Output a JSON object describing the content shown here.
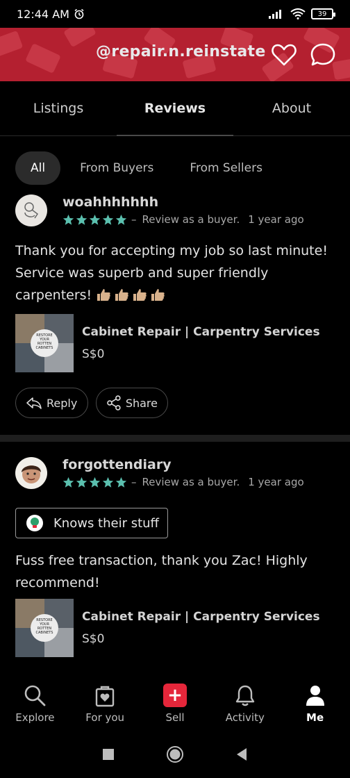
{
  "status": {
    "time": "12:44 AM",
    "battery": "39"
  },
  "header": {
    "handle": "@repair.n.reinstate",
    "accent": "#b42030"
  },
  "tabs": [
    {
      "label": "Listings"
    },
    {
      "label": "Reviews"
    },
    {
      "label": "About"
    }
  ],
  "filters": [
    {
      "label": "All"
    },
    {
      "label": "From Buyers"
    },
    {
      "label": "From Sellers"
    }
  ],
  "reviews": [
    {
      "username": "woahhhhhhh",
      "rating": 5,
      "separator": "–",
      "role": "Review as a buyer.",
      "time": "1 year ago",
      "text": "Thank you for accepting my job so last minute! Service was superb and super friendly carpenters!",
      "emoji_count": 4,
      "listing": {
        "title": "Cabinet Repair | Carpentry Services",
        "price": "S$0",
        "thumb_text": "RESTORE YOUR ROTTEN CABINETS"
      },
      "actions": {
        "reply": "Reply",
        "share": "Share"
      }
    },
    {
      "username": "forgottendiary",
      "rating": 5,
      "separator": "–",
      "role": "Review as a buyer.",
      "time": "1 year ago",
      "badge": "Knows their stuff",
      "text": "Fuss free transaction, thank you Zac! Highly recommend!",
      "listing": {
        "title": "Cabinet Repair | Carpentry Services",
        "price": "S$0",
        "thumb_text": "RESTORE YOUR ROTTEN CABINETS"
      }
    }
  ],
  "bottom_nav": [
    {
      "label": "Explore",
      "icon": "search-icon"
    },
    {
      "label": "For you",
      "icon": "shopping-bag-heart-icon"
    },
    {
      "label": "Sell",
      "icon": "plus-icon"
    },
    {
      "label": "Activity",
      "icon": "bell-icon"
    },
    {
      "label": "Me",
      "icon": "person-icon"
    }
  ],
  "colors": {
    "star": "#5bbfae",
    "sell": "#e5263a"
  }
}
